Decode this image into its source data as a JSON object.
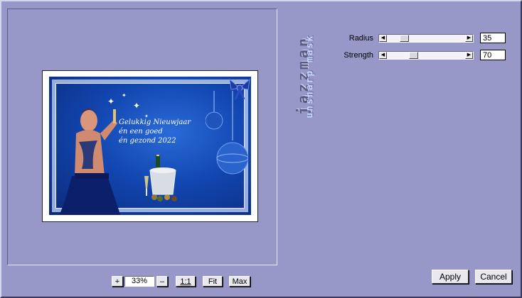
{
  "preview": {
    "image": {
      "greeting_lines": [
        "Gelukkig Nieuwjaar",
        "én een goed",
        "én gezond 2022"
      ]
    }
  },
  "branding": {
    "vendor": "jazzman",
    "filter": "unsharp mask"
  },
  "controls": {
    "radius": {
      "label": "Radius",
      "value": "35",
      "level_fraction": 0.35
    },
    "strength": {
      "label": "Strength",
      "value": "70",
      "level_fraction": 0.35
    }
  },
  "zoom": {
    "plus_label": "+",
    "value": "33%",
    "minus_label": "–",
    "one_to_one_label": "1:1",
    "fit_label": "Fit",
    "max_label": "Max"
  },
  "actions": {
    "apply_label": "Apply",
    "cancel_label": "Cancel"
  },
  "colors": {
    "background": "#9898c8",
    "card_blue": "#1246b0"
  }
}
